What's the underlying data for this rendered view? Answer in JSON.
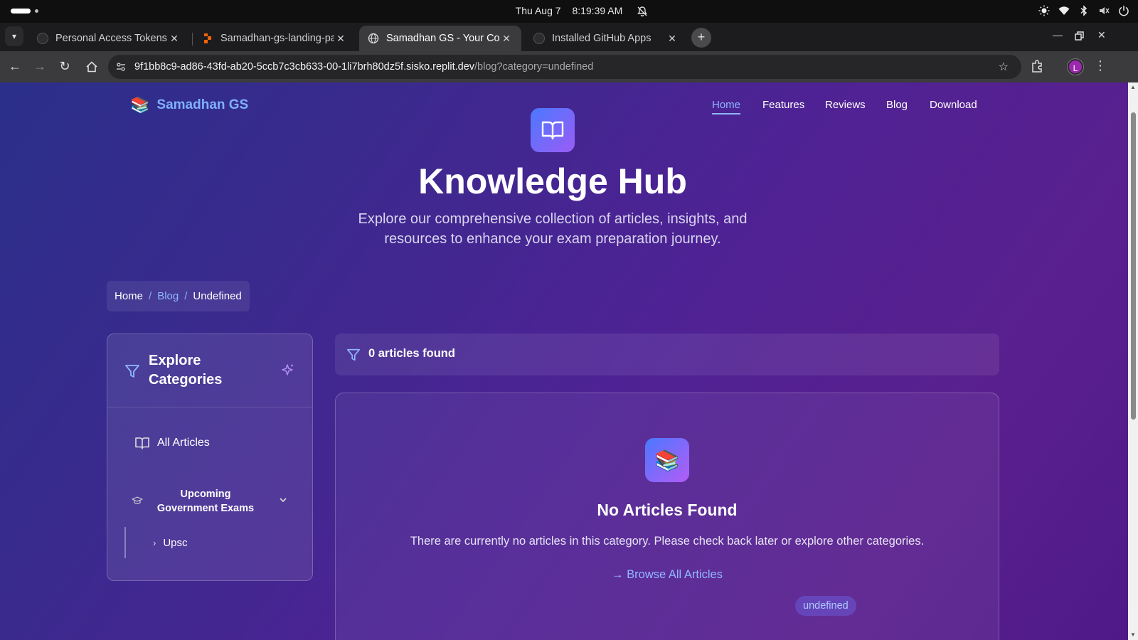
{
  "os": {
    "date": "Thu Aug 7",
    "time": "8:19:39 AM"
  },
  "tabs": [
    {
      "title": "Personal Access Tokens (",
      "favicon": "github-icon"
    },
    {
      "title": "Samadhan-gs-landing-pa",
      "favicon": "replit-icon"
    },
    {
      "title": "Samadhan GS - Your Com",
      "favicon": "globe-icon",
      "active": true
    },
    {
      "title": "Installed GitHub Apps",
      "favicon": "github-icon"
    }
  ],
  "address": {
    "host": "9f1bb8c9-ad86-43fd-ab20-5ccb7c3cb633-00-1li7brh80dz5f.sisko.replit.dev",
    "path": "/blog?category=undefined"
  },
  "profile_initial": "L",
  "site": {
    "brand": "Samadhan GS",
    "nav": [
      "Home",
      "Features",
      "Reviews",
      "Blog",
      "Download"
    ],
    "active_nav": "Home"
  },
  "hero": {
    "title": "Knowledge Hub",
    "subtitle": "Explore our comprehensive collection of articles, insights, and resources to enhance your exam preparation journey."
  },
  "breadcrumb": {
    "home": "Home",
    "blog": "Blog",
    "current": "Undefined"
  },
  "sidebar": {
    "title": "Explore Categories",
    "all_articles": "All Articles",
    "category": "Upcoming Government Exams",
    "subcategory": "Upsc"
  },
  "results": {
    "count_text": "0 articles found",
    "badge": "undefined"
  },
  "empty_state": {
    "title": "No Articles Found",
    "text": "There are currently no articles in this category. Please check back later or explore other categories.",
    "link": "Browse All Articles"
  },
  "colors": {
    "accent": "#8fb8ff",
    "brand": "#7fb0ff"
  }
}
